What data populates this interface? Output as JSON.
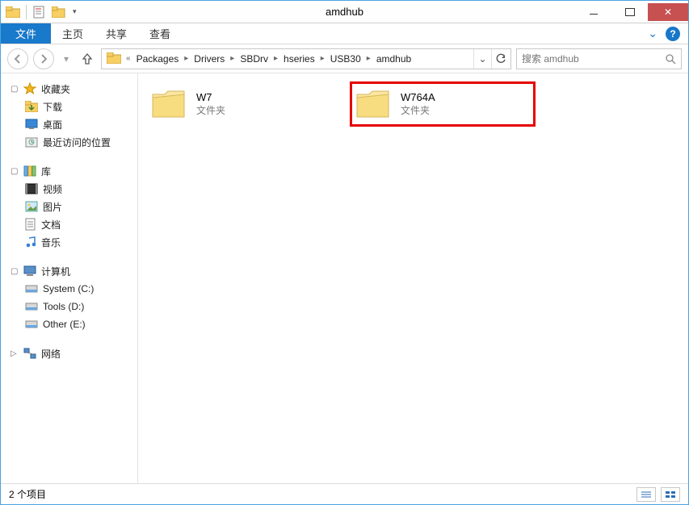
{
  "window": {
    "title": "amdhub"
  },
  "ribbon": {
    "file": "文件",
    "tabs": [
      "主页",
      "共享",
      "查看"
    ]
  },
  "breadcrumb": {
    "items": [
      "Packages",
      "Drivers",
      "SBDrv",
      "hseries",
      "USB30",
      "amdhub"
    ]
  },
  "search": {
    "placeholder": "搜索 amdhub"
  },
  "tree": {
    "favorites": {
      "label": "收藏夹",
      "items": [
        "下载",
        "桌面",
        "最近访问的位置"
      ]
    },
    "libraries": {
      "label": "库",
      "items": [
        "视频",
        "图片",
        "文档",
        "音乐"
      ]
    },
    "computer": {
      "label": "计算机",
      "items": [
        "System (C:)",
        "Tools (D:)",
        "Other (E:)"
      ]
    },
    "network": {
      "label": "网络"
    }
  },
  "content": {
    "items": [
      {
        "name": "W7",
        "type": "文件夹",
        "highlight": false
      },
      {
        "name": "W764A",
        "type": "文件夹",
        "highlight": true
      }
    ]
  },
  "status": {
    "text": "2 个项目"
  }
}
